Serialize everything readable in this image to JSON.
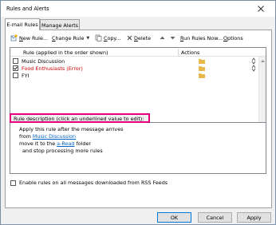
{
  "window": {
    "title": "Rules and Alerts"
  },
  "tabs": [
    {
      "label": "E-mail Rules",
      "active": true
    },
    {
      "label": "Manage Alerts",
      "active": false
    }
  ],
  "toolbar": {
    "new_rule": "New Rule...",
    "change_rule": "Change Rule",
    "copy": "Copy...",
    "delete": "Delete",
    "run_rules_now": "Run Rules Now...",
    "options": "Options"
  },
  "rules_list": {
    "columns": {
      "rule": "Rule (applied in the order shown)",
      "actions": "Actions"
    },
    "rows": [
      {
        "name": "Music Discussion",
        "checked": false,
        "error": false
      },
      {
        "name": "Food Enthusiasts  (Error)",
        "checked": true,
        "error": true
      },
      {
        "name": "FYI",
        "checked": false,
        "error": false
      }
    ]
  },
  "description": {
    "label": "Rule description (click an underlined value to edit):",
    "line1": "Apply this rule after the message arrives",
    "line2_prefix": "from ",
    "line2_link": "Music Discussion",
    "line3_prefix": "move it to the ",
    "line3_link": "a-Read",
    "line3_suffix": " folder",
    "line4": "and stop processing more rules"
  },
  "rss_option": {
    "label": "Enable rules on all messages downloaded from RSS Feeds",
    "checked": false
  },
  "buttons": {
    "ok": "OK",
    "cancel": "Cancel",
    "apply": "Apply"
  },
  "colors": {
    "highlight_border": "#e4007c",
    "error_text": "#cc0000",
    "link": "#0563c1",
    "folder_icon": "#e8b94a"
  }
}
